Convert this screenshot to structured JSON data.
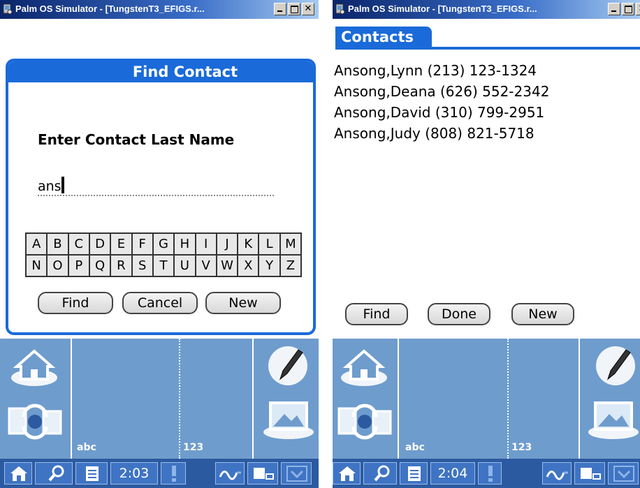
{
  "left_window": {
    "title": "Palm OS Simulator - [TungstenT3_EFIGS.r...",
    "dialog": {
      "title": "Find Contact",
      "label": "Enter Contact Last Name",
      "input_value": "ans",
      "keyboard_rows": [
        [
          "A",
          "B",
          "C",
          "D",
          "E",
          "F",
          "G",
          "H",
          "I",
          "J",
          "K",
          "L",
          "M"
        ],
        [
          "N",
          "O",
          "P",
          "Q",
          "R",
          "S",
          "T",
          "U",
          "V",
          "W",
          "X",
          "Y",
          "Z"
        ]
      ],
      "buttons": {
        "find": "Find",
        "cancel": "Cancel",
        "new": "New"
      }
    },
    "graffiti": {
      "abc": "abc",
      "num": "123"
    },
    "status": {
      "time": "2:03"
    }
  },
  "right_window": {
    "title": "Palm OS Simulator - [TungstenT3_EFIGS.r...",
    "tab": "Contacts",
    "contacts": [
      "Ansong,Lynn (213) 123-1324",
      "Ansong,Deana (626) 552-2342",
      "Ansong,David (310) 799-2951",
      "Ansong,Judy (808) 821-5718"
    ],
    "buttons": {
      "find": "Find",
      "done": "Done",
      "new": "New"
    },
    "graffiti": {
      "abc": "abc",
      "num": "123"
    },
    "status": {
      "time": "2:04"
    }
  },
  "icons": {
    "home": "home-icon",
    "sync": "sync-icon",
    "pen": "pen-icon",
    "picture": "picture-icon",
    "find": "find-icon",
    "menu": "menu-icon",
    "alert": "alert-icon"
  },
  "colors": {
    "palm_blue": "#1a6ad9",
    "graffiti": "#6e9ccd",
    "statusbar": "#2c5aa0"
  }
}
